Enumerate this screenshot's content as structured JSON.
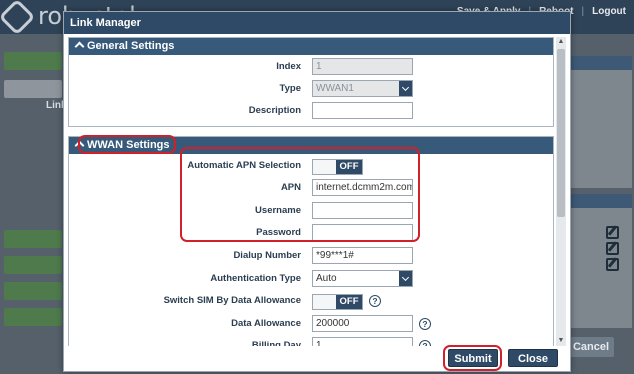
{
  "background": {
    "logo_text": "robustel",
    "nav": [
      "Save & Apply",
      "Reboot",
      "Logout"
    ],
    "side_label": "Link",
    "cancel_label": "Cancel"
  },
  "dialog": {
    "title": "Link Manager",
    "general": {
      "header": "General Settings",
      "index_label": "Index",
      "index_value": "1",
      "type_label": "Type",
      "type_value": "WWAN1",
      "description_label": "Description",
      "description_value": ""
    },
    "wwan": {
      "header": "WWAN Settings",
      "apn_selection_label": "Automatic APN Selection",
      "apn_selection_state": "OFF",
      "apn_label": "APN",
      "apn_value": "internet.dcmm2m.com",
      "username_label": "Username",
      "username_value": "",
      "password_label": "Password",
      "password_value": "",
      "dialup_label": "Dialup Number",
      "dialup_value": "*99***1#",
      "auth_label": "Authentication Type",
      "auth_value": "Auto",
      "switch_sim_label": "Switch SIM By Data Allowance",
      "switch_sim_state": "OFF",
      "data_allowance_label": "Data Allowance",
      "data_allowance_value": "200000",
      "billing_day_label": "Billing Day",
      "billing_day_value": "1"
    },
    "buttons": {
      "submit": "Submit",
      "close": "Close"
    }
  },
  "colors": {
    "header_bar": "#2f4a66",
    "section_header": "#37597a",
    "highlight": "#d0202a"
  }
}
